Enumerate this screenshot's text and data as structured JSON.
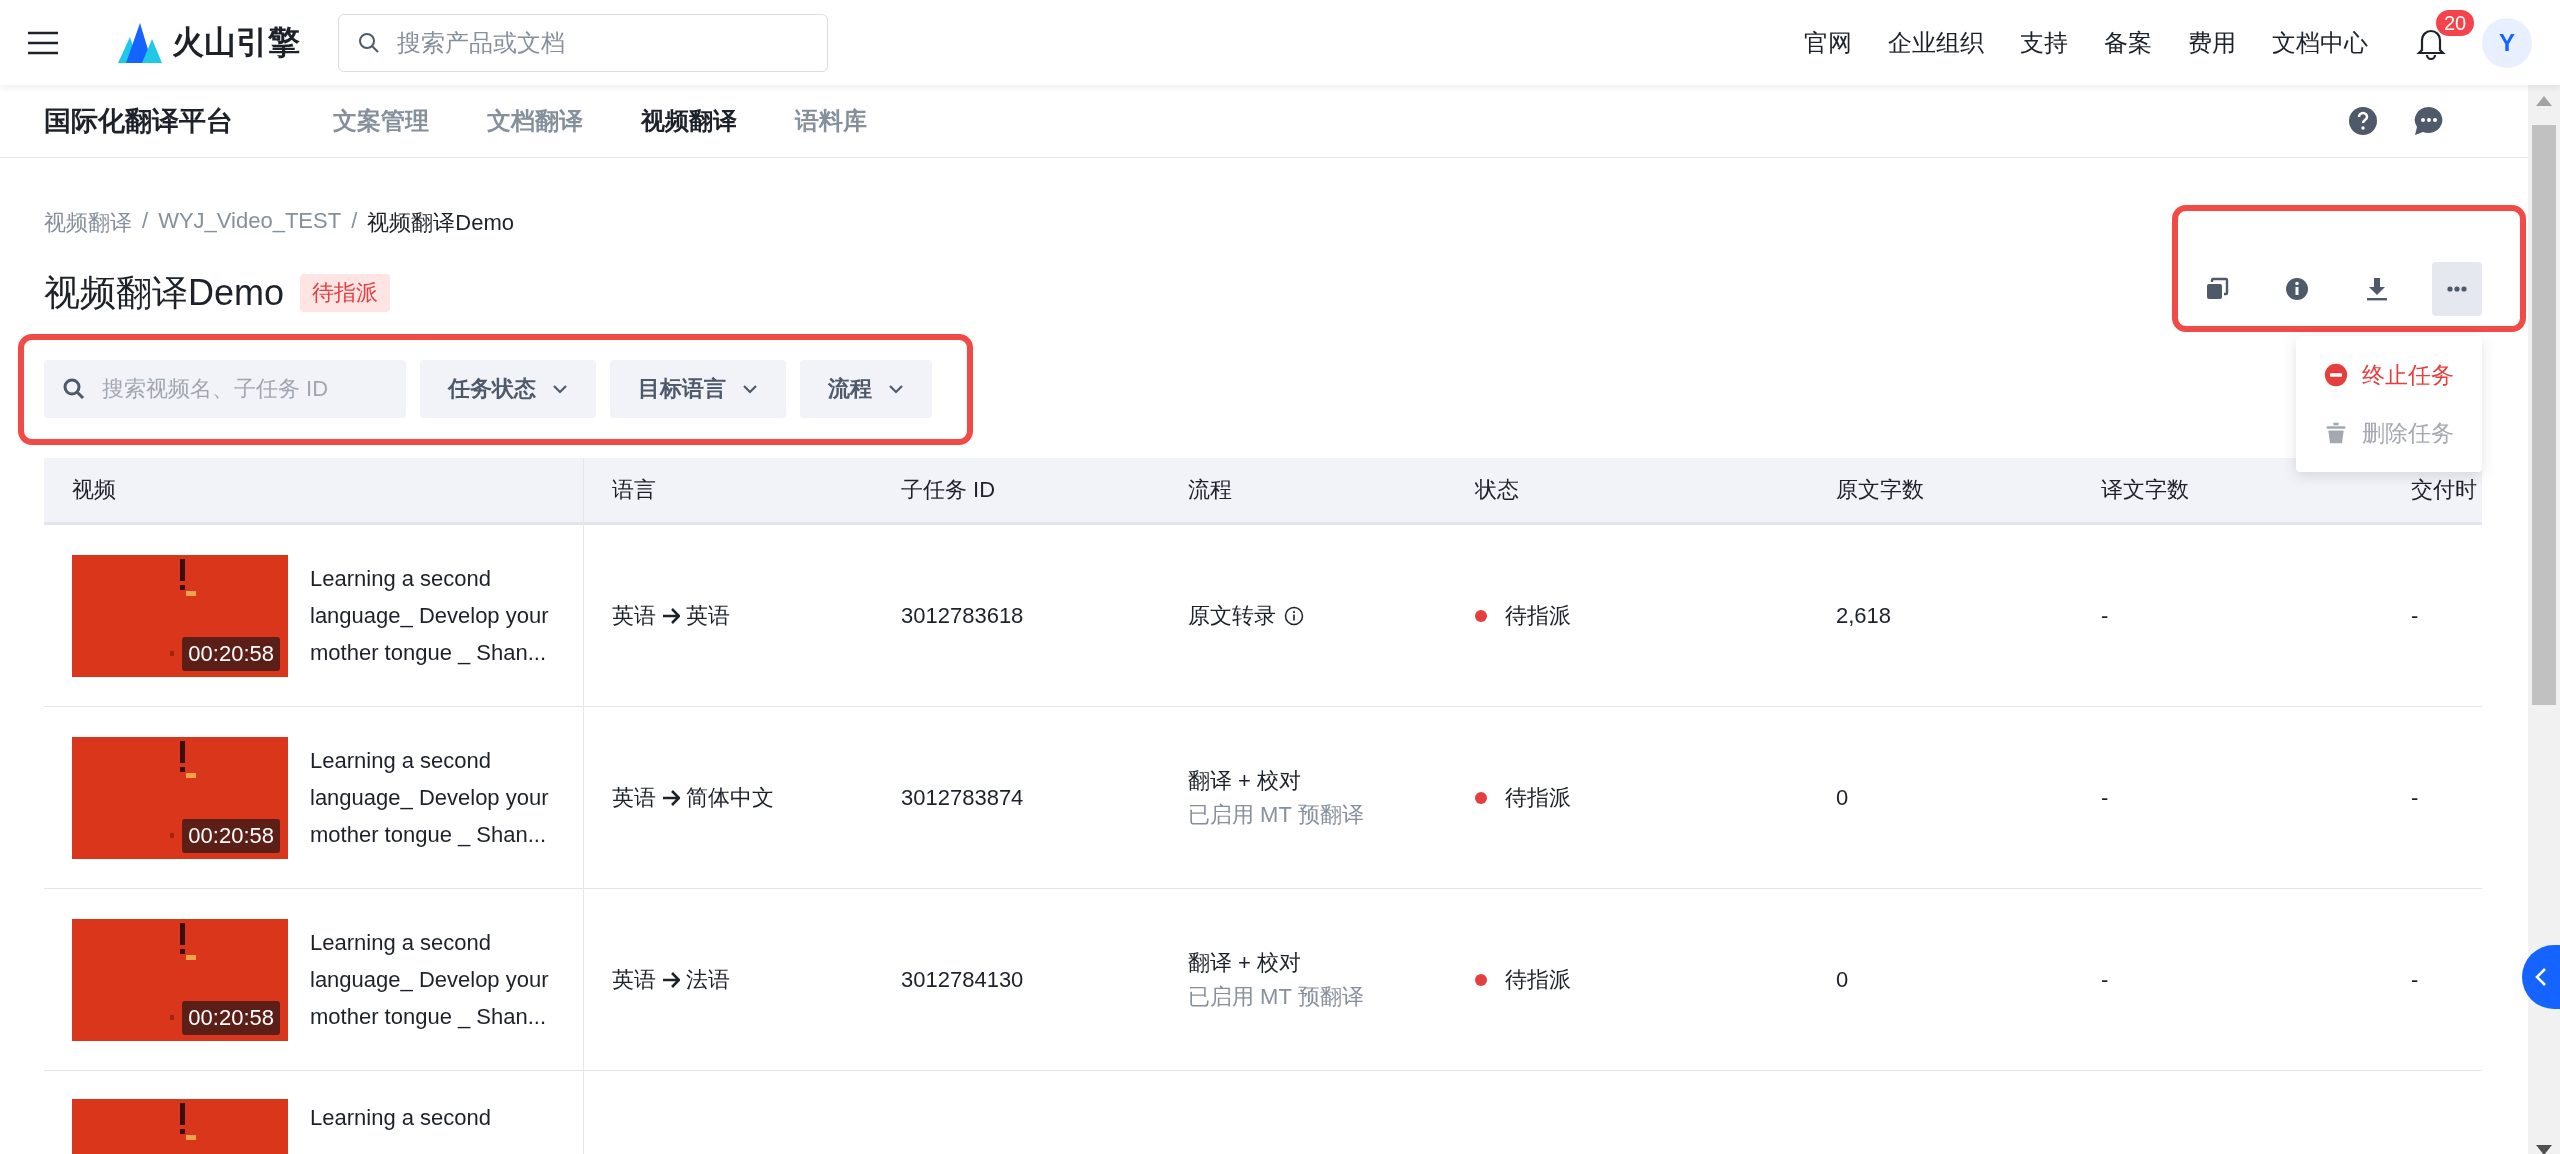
{
  "header": {
    "logo_text": "火山引擎",
    "search": {
      "placeholder": "搜索产品或文档"
    },
    "links": [
      "官网",
      "企业组织",
      "支持",
      "备案",
      "费用",
      "文档中心"
    ],
    "notification_count": "20",
    "avatar": "Y"
  },
  "subnav": {
    "title": "国际化翻译平台",
    "tabs": [
      {
        "label": "文案管理",
        "selected": false
      },
      {
        "label": "文档翻译",
        "selected": false
      },
      {
        "label": "视频翻译",
        "selected": true
      },
      {
        "label": "语料库",
        "selected": false
      }
    ]
  },
  "breadcrumb": {
    "items": [
      "视频翻译",
      "WYJ_Video_TEST",
      "视频翻译Demo"
    ],
    "separator": "/"
  },
  "page": {
    "title": "视频翻译Demo",
    "status_tag": "待指派"
  },
  "filters": {
    "search": {
      "placeholder": "搜索视频名、子任务 ID"
    },
    "dropdowns": [
      "任务状态",
      "目标语言",
      "流程"
    ]
  },
  "menu": {
    "items": [
      {
        "label": "终止任务",
        "kind": "stop",
        "disabled": false
      },
      {
        "label": "删除任务",
        "kind": "delete",
        "disabled": true
      }
    ]
  },
  "table": {
    "columns": [
      "视频",
      "语言",
      "子任务 ID",
      "流程",
      "状态",
      "原文字数",
      "译文字数",
      "交付时"
    ],
    "rows": [
      {
        "title": "Learning a second language_ Develop your mother tongue _ Shan...",
        "duration": "00:20:58",
        "from": "英语",
        "to": "英语",
        "id": "3012783618",
        "flow": "原文转录",
        "flow_info": true,
        "status": "待指派",
        "color": "#e53e3e",
        "source_count": "2,618",
        "target_count": "-",
        "delivery": "-"
      },
      {
        "title": "Learning a second language_ Develop your mother tongue _ Shan...",
        "duration": "00:20:58",
        "from": "英语",
        "to": "简体中文",
        "id": "3012783874",
        "flow": "翻译 + 校对",
        "flow_note": "已启用 MT 预翻译",
        "status": "待指派",
        "color": "#e53e3e",
        "source_count": "0",
        "target_count": "-",
        "delivery": "-"
      },
      {
        "title": "Learning a second language_ Develop your mother tongue _ Shan...",
        "duration": "00:20:58",
        "from": "英语",
        "to": "法语",
        "id": "3012784130",
        "flow": "翻译 + 校对",
        "flow_note": "已启用 MT 预翻译",
        "status": "待指派",
        "color": "#e53e3e",
        "source_count": "0",
        "target_count": "-",
        "delivery": "-"
      },
      {
        "title": "Learning a second"
      }
    ]
  }
}
